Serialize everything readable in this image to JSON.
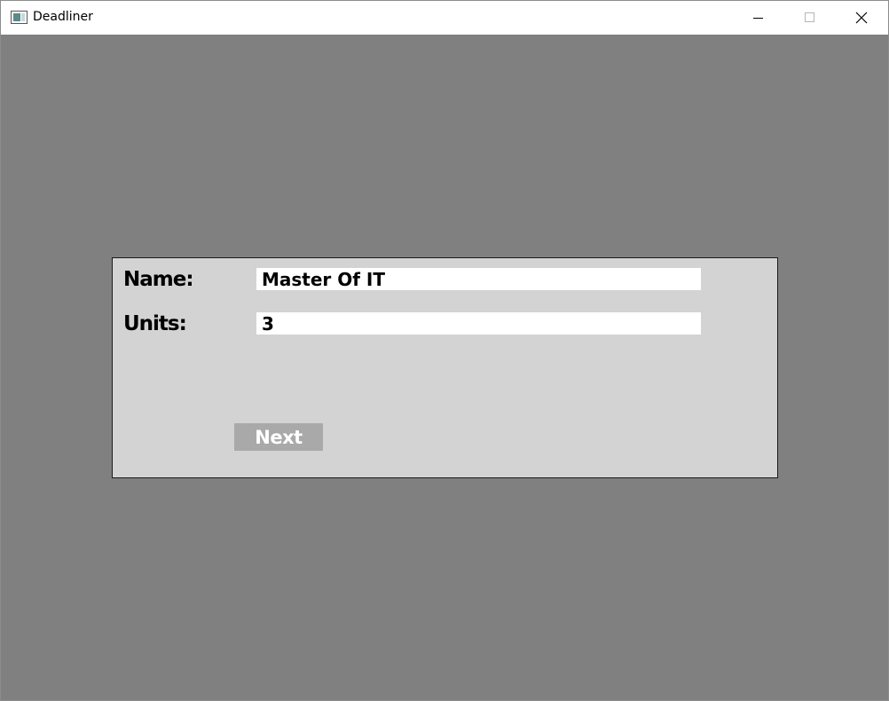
{
  "window": {
    "title": "Deadliner",
    "icon": "app-window-icon",
    "controls": {
      "minimize_icon": "minimize-icon",
      "maximize_icon": "maximize-icon",
      "close_icon": "close-icon"
    }
  },
  "form": {
    "name_label": "Name:",
    "name_value": "Master Of IT",
    "units_label": "Units:",
    "units_value": "3",
    "next_label": "Next"
  },
  "colors": {
    "background": "#808080",
    "panel": "#d3d3d3",
    "button": "#a9a9a9",
    "button_text": "#ffffff"
  }
}
